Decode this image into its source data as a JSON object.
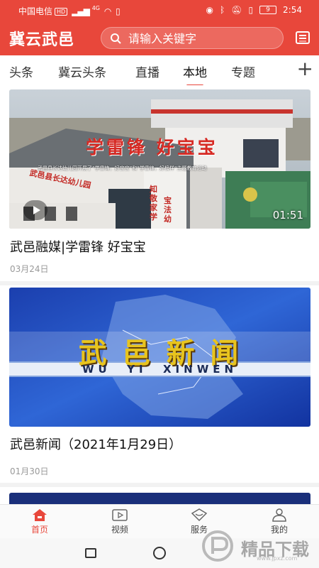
{
  "status_bar": {
    "carrier": "中国电信",
    "hd": "HD",
    "network": "4G",
    "battery": "9",
    "time": "2:54"
  },
  "header": {
    "app_title": "冀云武邑",
    "search_placeholder": "请输入关键字"
  },
  "tabs": [
    {
      "label": "头条",
      "active": false
    },
    {
      "label": "冀云头条",
      "active": false
    },
    {
      "label": "直播",
      "active": false
    },
    {
      "label": "本地",
      "active": true
    },
    {
      "label": "专题",
      "active": false
    }
  ],
  "feed": [
    {
      "title": "武邑融媒|学雷锋 好宝宝",
      "date": "03月24日",
      "duration": "01:51",
      "thumb_banner": "学雷锋 好宝宝",
      "thumb_caption": "武邑县长达幼儿园开展了“学雷锋，好宝宝”和“学雷锋，好榜样”主题教育活动",
      "thumb_sign_1": "武邑县长达幼儿园",
      "thumb_sign_2": "知敬家学",
      "thumb_sign_3": "宝法幼"
    },
    {
      "title": "武邑新闻（2021年1月29日）",
      "date": "01月30日",
      "thumb_title": "武 邑 新 闻",
      "thumb_subtitle": "WU  YI  XINWEN"
    }
  ],
  "bottom_nav": [
    {
      "label": "首页",
      "icon": "home-icon",
      "active": true
    },
    {
      "label": "视频",
      "icon": "video-icon",
      "active": false
    },
    {
      "label": "服务",
      "icon": "service-icon",
      "active": false
    },
    {
      "label": "我的",
      "icon": "user-icon",
      "active": false
    }
  ],
  "watermark": {
    "text": "精品下载",
    "url_text": "www.jpxz.com"
  },
  "colors": {
    "brand_red": "#e8473b",
    "text_gray": "#999999"
  }
}
